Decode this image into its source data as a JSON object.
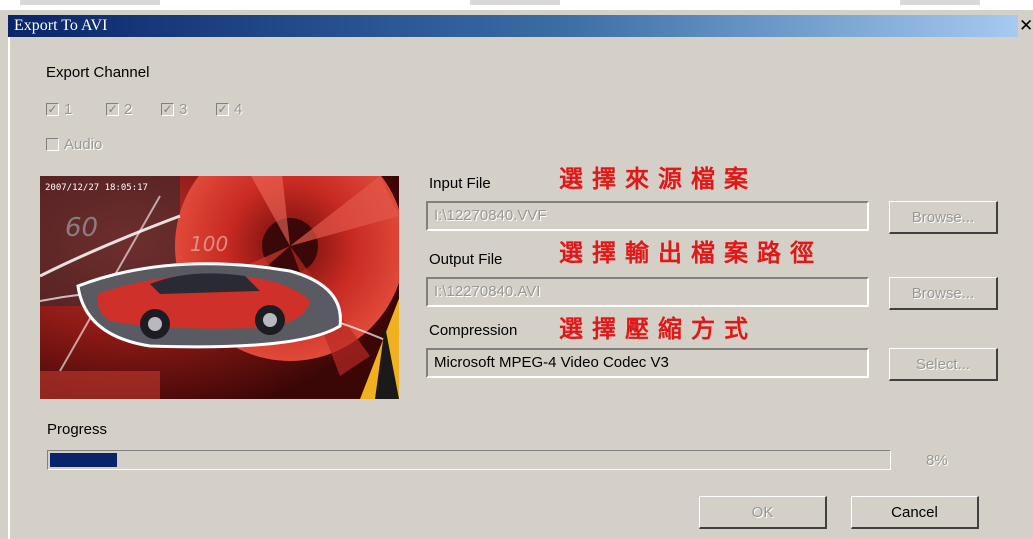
{
  "window": {
    "title": "Export To AVI",
    "close_glyph": "✕"
  },
  "export_channel": {
    "label": "Export Channel",
    "channels": [
      {
        "label": "1",
        "checked": true
      },
      {
        "label": "2",
        "checked": true
      },
      {
        "label": "3",
        "checked": true
      },
      {
        "label": "4",
        "checked": true
      }
    ],
    "audio": {
      "label": "Audio",
      "checked": false
    }
  },
  "preview": {
    "timestamp": "2007/12/27 18:05:17"
  },
  "input_file": {
    "label": "Input File",
    "value": "I:\\12270840.VVF",
    "browse_label": "Browse..."
  },
  "output_file": {
    "label": "Output File",
    "value": "I:\\12270840.AVI",
    "browse_label": "Browse..."
  },
  "compression": {
    "label": "Compression",
    "value": "Microsoft MPEG-4 Video Codec V3",
    "select_label": "Select..."
  },
  "annotations": {
    "input": "選擇來源檔案",
    "output": "選擇輸出檔案路徑",
    "compression": "選擇壓縮方式",
    "color": "#e01818"
  },
  "progress": {
    "label": "Progress",
    "value": 0.08,
    "text": "8%"
  },
  "buttons": {
    "ok_label": "OK",
    "cancel_label": "Cancel"
  },
  "colors": {
    "title_start": "#0a246a",
    "title_end": "#a6caf0",
    "dialog_bg": "#d4d0c8",
    "progress_fill": "#0a246a"
  }
}
